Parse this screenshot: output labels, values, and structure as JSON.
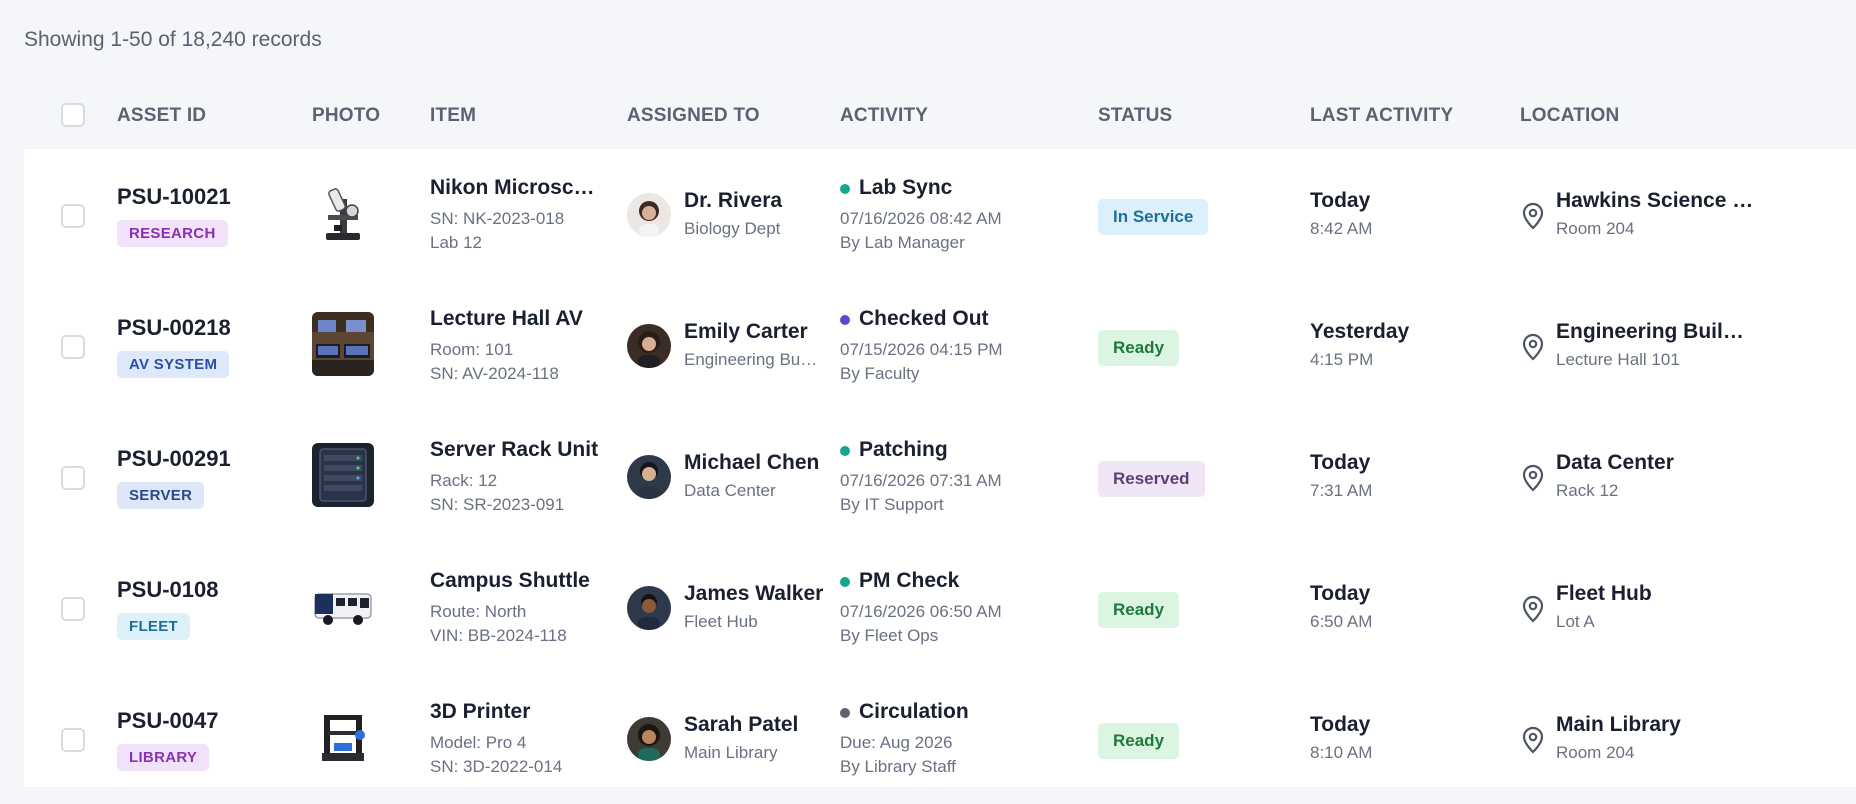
{
  "summary": "Showing 1-50 of 18,240 records",
  "columns": {
    "asset_id": "ASSET ID",
    "photo": "PHOTO",
    "item": "ITEM",
    "assigned_to": "ASSIGNED TO",
    "activity": "ACTIVITY",
    "status": "STATUS",
    "last_activity": "LAST ACTIVITY",
    "location": "LOCATION"
  },
  "rows": [
    {
      "asset_id": "PSU-10021",
      "category": "RESEARCH",
      "item_title": "Nikon Microscope",
      "item_line1": "SN: NK-2023-018",
      "item_line2": "Lab 12",
      "person_name": "Dr. Rivera",
      "person_dept": "Biology Dept",
      "activity_title": "Lab Sync",
      "activity_time": "07/16/2026 08:42 AM",
      "activity_by": "By Lab Manager",
      "status": "In Service",
      "last_day": "Today",
      "last_time": "8:42 AM",
      "location_name": "Hawkins Science Hall",
      "location_room": "Room 204"
    },
    {
      "asset_id": "PSU-00218",
      "category": "AV SYSTEM",
      "item_title": "Lecture Hall AV",
      "item_line1": "Room: 101",
      "item_line2": "SN: AV-2024-118",
      "person_name": "Emily Carter",
      "person_dept": "Engineering Building",
      "activity_title": "Checked Out",
      "activity_time": "07/15/2026 04:15 PM",
      "activity_by": "By Faculty",
      "status": "Ready",
      "last_day": "Yesterday",
      "last_time": "4:15 PM",
      "location_name": "Engineering Building",
      "location_room": "Lecture Hall 101"
    },
    {
      "asset_id": "PSU-00291",
      "category": "SERVER",
      "item_title": "Server Rack Unit",
      "item_line1": "Rack: 12",
      "item_line2": "SN: SR-2023-091",
      "person_name": "Michael Chen",
      "person_dept": "Data Center",
      "activity_title": "Patching",
      "activity_time": "07/16/2026 07:31 AM",
      "activity_by": "By IT Support",
      "status": "Reserved",
      "last_day": "Today",
      "last_time": "7:31 AM",
      "location_name": "Data Center",
      "location_room": "Rack 12"
    },
    {
      "asset_id": "PSU-0108",
      "category": "FLEET",
      "item_title": "Campus Shuttle",
      "item_line1": "Route: North",
      "item_line2": "VIN: BB-2024-118",
      "person_name": "James Walker",
      "person_dept": "Fleet Hub",
      "activity_title": "PM Check",
      "activity_time": "07/16/2026 06:50 AM",
      "activity_by": "By Fleet Ops",
      "status": "Ready",
      "last_day": "Today",
      "last_time": "6:50 AM",
      "location_name": "Fleet Hub",
      "location_room": "Lot A"
    },
    {
      "asset_id": "PSU-0047",
      "category": "LIBRARY",
      "item_title": "3D Printer",
      "item_line1": "Model: Pro 4",
      "item_line2": "SN: 3D-2022-014",
      "person_name": "Sarah Patel",
      "person_dept": "Main Library",
      "activity_title": "Circulation",
      "activity_time": "Due: Aug 2026",
      "activity_by": "By Library Staff",
      "status": "Ready",
      "last_day": "Today",
      "last_time": "8:10 AM",
      "location_name": "Main Library",
      "location_room": "Room 204"
    }
  ],
  "colors": {
    "research_bg": "#f3e3fa",
    "research_fg": "#8a2fb2",
    "av_bg": "#dde8fb",
    "av_fg": "#2a4fa6",
    "server_bg": "#dde7f8",
    "server_fg": "#2b4a8c",
    "fleet_bg": "#ddf1fa",
    "fleet_fg": "#1f6f93",
    "library_bg": "#f1e2fa",
    "library_fg": "#8a33b0",
    "in_service_bg": "#dcf0fb",
    "in_service_fg": "#1f6f9c",
    "ready_bg": "#dcf5e3",
    "ready_fg": "#1f7a3d",
    "reserved_bg": "#efe6f5",
    "reserved_fg": "#5e3f75",
    "dot_teal": "#14a88a",
    "dot_indigo": "#5a49d6",
    "dot_gray": "#5d6470"
  }
}
